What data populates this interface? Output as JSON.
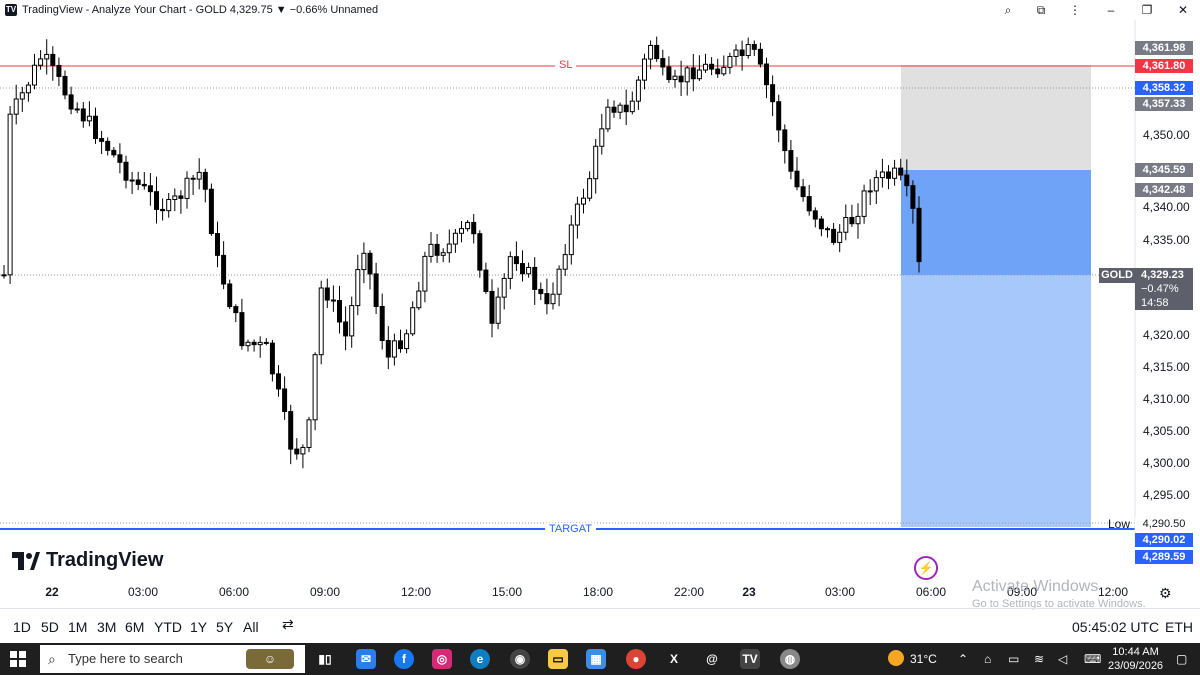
{
  "window": {
    "title": "TradingView - Analyze Your Chart - GOLD 4,329.75 ▼ −0.66% Unnamed",
    "icons": [
      "zoom-icon",
      "extension-icon",
      "menu-icon",
      "minimize-icon",
      "restore-icon",
      "close-icon"
    ]
  },
  "chart": {
    "symbol": "GOLD",
    "sl_label": "SL",
    "target_label": "TARGAT",
    "low_label": "Low",
    "colors": {
      "up": "#ffffff",
      "down": "#000000",
      "stop_zone": "#e0e0e0",
      "entry_zone": "#6fa3f7",
      "target_zone": "#a6c8fa",
      "sl_line": "#f23645",
      "target_line": "#2962ff"
    },
    "price_axis_ticks": [
      "4,350.00",
      "4,340.00",
      "4,335.00",
      "4,320.00",
      "4,315.00",
      "4,310.00",
      "4,305.00",
      "4,300.00",
      "4,295.00"
    ],
    "price_tags": [
      {
        "label": "4,361.98",
        "color": "#787b86"
      },
      {
        "label": "4,361.80",
        "color": "#f23645"
      },
      {
        "label": "4,358.32",
        "color": "#2962ff"
      },
      {
        "label": "4,357.33",
        "color": "#787b86"
      },
      {
        "label": "4,345.59",
        "color": "#787b86"
      },
      {
        "label": "4,342.48",
        "color": "#787b86"
      },
      {
        "label": "4,290.50",
        "color": "#ffffff"
      },
      {
        "label": "4,290.02",
        "color": "#2962ff"
      },
      {
        "label": "4,289.59",
        "color": "#2962ff"
      }
    ],
    "current": {
      "symbol": "GOLD",
      "price": "4,329.23",
      "change": "−0.47%",
      "countdown": "14:58"
    }
  },
  "branding": {
    "name": "TradingView"
  },
  "time_axis": [
    "22",
    "03:00",
    "06:00",
    "09:00",
    "12:00",
    "15:00",
    "18:00",
    "22:00",
    "23",
    "03:00",
    "06:00",
    "09:00",
    "12:00"
  ],
  "watermark": {
    "line1": "Activate Windows",
    "line2": "Go to Settings to activate Windows."
  },
  "bottom_toolbar": {
    "ranges": [
      "1D",
      "5D",
      "1M",
      "3M",
      "6M",
      "YTD",
      "1Y",
      "5Y",
      "All"
    ],
    "clock": "05:45:02 UTC",
    "session": "ETH"
  },
  "taskbar": {
    "search_placeholder": "Type here to search",
    "weather": "31°C",
    "time": "10:44 AM",
    "date": "23/09/2026",
    "apps": [
      "task-view-icon",
      "mail-icon",
      "facebook-icon",
      "instagram-icon",
      "edge-icon",
      "camera-icon",
      "file-explorer-icon",
      "store-icon",
      "chrome-icon",
      "x-icon",
      "threads-icon",
      "tradingview-icon",
      "app-icon"
    ]
  }
}
